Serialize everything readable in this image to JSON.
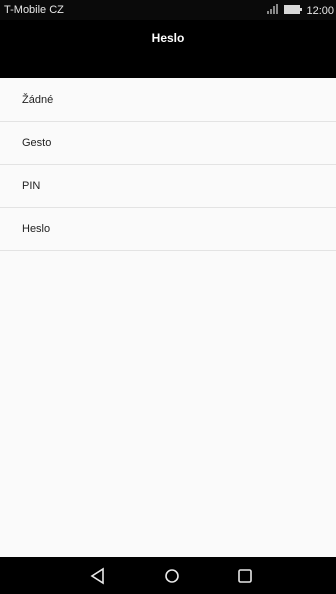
{
  "status_bar": {
    "carrier": "T-Mobile CZ",
    "time": "12:00",
    "icons": [
      "signal-icon",
      "battery-icon"
    ]
  },
  "header": {
    "title": "Heslo"
  },
  "list": {
    "items": [
      {
        "label": "Žádné"
      },
      {
        "label": "Gesto"
      },
      {
        "label": "PIN"
      },
      {
        "label": "Heslo"
      }
    ]
  },
  "nav_bar": {
    "buttons": [
      "back-icon",
      "home-icon",
      "recents-icon"
    ]
  },
  "colors": {
    "bar_background": "#000000",
    "list_background": "#fafafa",
    "divider": "#e3e3e3"
  }
}
